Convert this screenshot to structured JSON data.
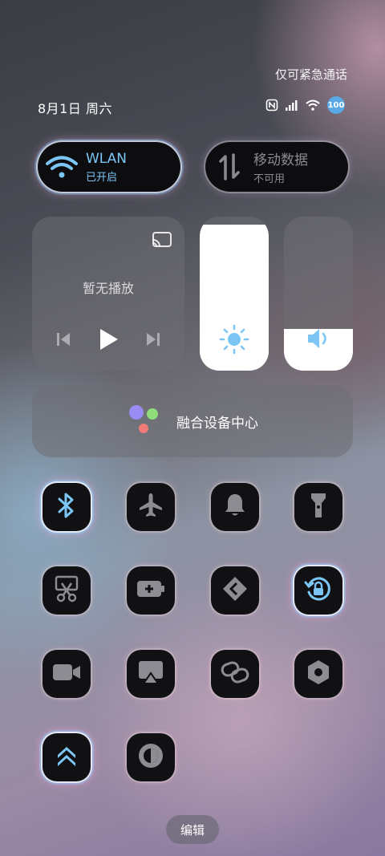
{
  "header": {
    "emergency_text": "仅可紧急通话",
    "date_text": "8月1日 周六",
    "battery_level": "100"
  },
  "status_icons": [
    "nfc-icon",
    "signal-icon",
    "wifi-icon",
    "battery-icon"
  ],
  "connectivity": {
    "wlan": {
      "title": "WLAN",
      "status": "已开启",
      "active": true,
      "color": "#7cc6f5"
    },
    "mobile_data": {
      "title": "移动数据",
      "status": "不可用",
      "active": false
    }
  },
  "media": {
    "title": "暂无播放",
    "icons": [
      "cast-icon",
      "previous-icon",
      "play-icon",
      "next-icon"
    ]
  },
  "sliders": {
    "brightness": {
      "level": 0.95,
      "icon": "sun-icon"
    },
    "volume": {
      "level": 0.27,
      "icon": "speaker-icon"
    }
  },
  "fusion_center": {
    "label": "融合设备中心"
  },
  "toggles": [
    {
      "name": "bluetooth",
      "icon": "bluetooth-icon",
      "active": true
    },
    {
      "name": "airplane-mode",
      "icon": "airplane-icon",
      "active": false
    },
    {
      "name": "ringer",
      "icon": "bell-icon",
      "active": false
    },
    {
      "name": "flashlight",
      "icon": "flashlight-icon",
      "active": false
    },
    {
      "name": "screenshot",
      "icon": "scissors-icon",
      "active": false
    },
    {
      "name": "battery-saver",
      "icon": "battery-plus-icon",
      "active": false
    },
    {
      "name": "nearby-share",
      "icon": "share-icon",
      "active": false
    },
    {
      "name": "rotation-lock",
      "icon": "rotation-lock-icon",
      "active": true
    },
    {
      "name": "screen-record",
      "icon": "video-camera-icon",
      "active": false
    },
    {
      "name": "screen-cast",
      "icon": "airplay-icon",
      "active": false
    },
    {
      "name": "link",
      "icon": "link-icon",
      "active": false
    },
    {
      "name": "settings",
      "icon": "hexagon-icon",
      "active": false
    },
    {
      "name": "performance-mode",
      "icon": "double-chevron-up-icon",
      "active": true
    },
    {
      "name": "dark-mode",
      "icon": "contrast-icon",
      "active": false
    }
  ],
  "footer": {
    "edit_label": "编辑"
  }
}
